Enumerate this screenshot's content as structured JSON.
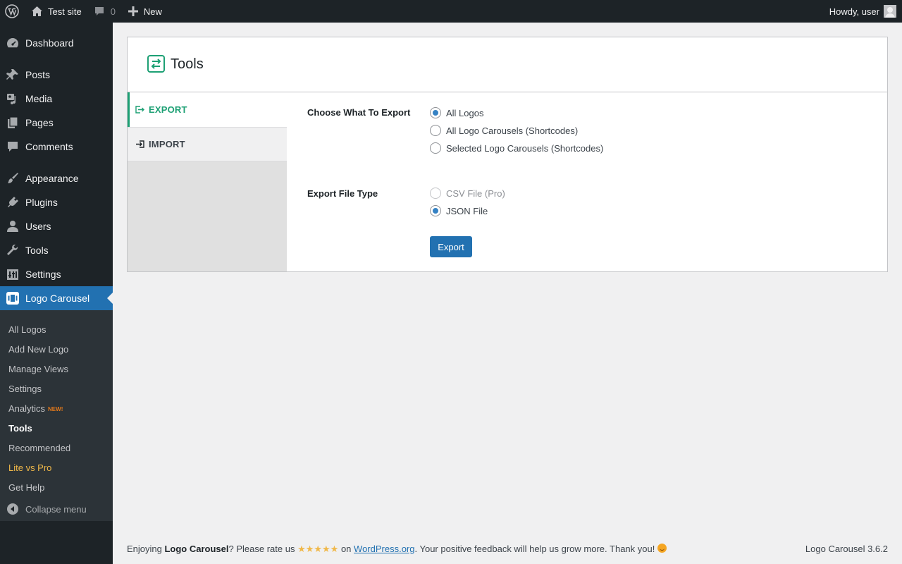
{
  "adminbar": {
    "site_name": "Test site",
    "comments_count": "0",
    "new_label": "New",
    "howdy": "Howdy, user"
  },
  "sidebar": {
    "items": [
      {
        "label": "Dashboard",
        "icon": "dashboard-icon"
      },
      {
        "label": "Posts",
        "icon": "pin-icon"
      },
      {
        "label": "Media",
        "icon": "media-icon"
      },
      {
        "label": "Pages",
        "icon": "pages-icon"
      },
      {
        "label": "Comments",
        "icon": "comment-icon"
      },
      {
        "label": "Appearance",
        "icon": "brush-icon"
      },
      {
        "label": "Plugins",
        "icon": "plug-icon"
      },
      {
        "label": "Users",
        "icon": "user-icon"
      },
      {
        "label": "Tools",
        "icon": "wrench-icon"
      },
      {
        "label": "Settings",
        "icon": "settings-icon"
      },
      {
        "label": "Logo Carousel",
        "icon": "logo-carousel-icon"
      }
    ],
    "submenu": [
      {
        "label": "All Logos"
      },
      {
        "label": "Add New Logo"
      },
      {
        "label": "Manage Views"
      },
      {
        "label": "Settings"
      },
      {
        "label": "Analytics",
        "badge": "NEW!"
      },
      {
        "label": "Tools"
      },
      {
        "label": "Recommended"
      },
      {
        "label": "Lite vs Pro"
      },
      {
        "label": "Get Help"
      }
    ],
    "collapse_label": "Collapse menu"
  },
  "page": {
    "title": "Tools",
    "tabs": [
      {
        "label": "EXPORT"
      },
      {
        "label": "IMPORT"
      }
    ],
    "choose_label": "Choose What To Export",
    "choose_options": [
      {
        "label": "All Logos",
        "checked": true
      },
      {
        "label": "All Logo Carousels (Shortcodes)",
        "checked": false
      },
      {
        "label": "Selected Logo Carousels (Shortcodes)",
        "checked": false
      }
    ],
    "filetype_label": "Export File Type",
    "filetype_options": [
      {
        "label": "CSV File (Pro)",
        "checked": false,
        "disabled": true
      },
      {
        "label": "JSON File",
        "checked": true,
        "disabled": false
      }
    ],
    "export_button": "Export"
  },
  "footer": {
    "enjoying": "Enjoying ",
    "plugin_name": "Logo Carousel",
    "rate_us": "? Please rate us ",
    "stars": "★★★★★",
    "on": " on ",
    "link": "WordPress.org",
    "thanks": ". Your positive feedback will help us grow more. Thank you! ",
    "version": "Logo Carousel 3.6.2"
  },
  "colors": {
    "adminbar": "#1d2327",
    "accent": "#2271b1",
    "tab_active": "#1da074",
    "pro_link": "#f0b849",
    "stars": "#f0b849"
  }
}
